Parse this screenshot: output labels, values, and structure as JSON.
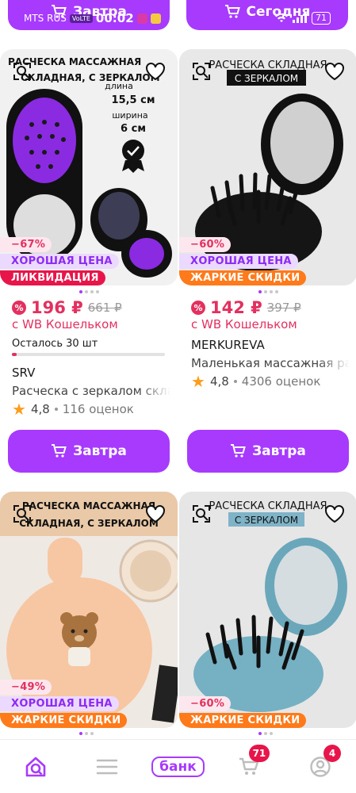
{
  "status_bar": {
    "carrier": "MTS RUS",
    "network": "VoLTE",
    "time": "00:02",
    "battery": "71"
  },
  "top_buttons": [
    {
      "label": "Завтра"
    },
    {
      "label": "Сегодня"
    }
  ],
  "products": [
    {
      "image_text": {
        "line1": "РАСЧЕСКА МАССАЖНАЯ",
        "line2": "СКЛАДНАЯ, С ЗЕРКАЛОМ",
        "length_label": "длина",
        "length_value": "15,5 см",
        "width_label": "ширина",
        "width_value": "6 см"
      },
      "discount": "−67%",
      "badge_primary": "ХОРОШАЯ ЦЕНА",
      "badge_secondary": "ЛИКВИДАЦИЯ",
      "price": "196 ₽",
      "old_price": "661 ₽",
      "wallet_note": "с WB Кошельком",
      "stock_label": "Осталось 30 шт",
      "stock_fraction": 0.03,
      "brand": "SRV",
      "title": "Расческа с зеркалом складная",
      "rating": "4,8",
      "reviews": "116 оценок",
      "buy_label": "Завтра"
    },
    {
      "image_text": {
        "line1": "РАСЧЕСКА СКЛАДНАЯ",
        "line2": "С ЗЕРКАЛОМ"
      },
      "discount": "−60%",
      "badge_primary": "ХОРОШАЯ ЦЕНА",
      "badge_secondary": "ЖАРКИЕ СКИДКИ",
      "price": "142 ₽",
      "old_price": "397 ₽",
      "wallet_note": "с WB Кошельком",
      "brand": "MERKUREVA",
      "title": "Маленькая массажная расческа",
      "rating": "4,8",
      "reviews": "4306 оценок",
      "buy_label": "Завтра"
    },
    {
      "image_text": {
        "line1": "РАСЧЕСКА МАССАЖНАЯ",
        "line2": "СКЛАДНАЯ, С ЗЕРКАЛОМ"
      },
      "discount": "−49%",
      "badge_primary": "ХОРОШАЯ ЦЕНА",
      "badge_secondary": "ЖАРКИЕ СКИДКИ"
    },
    {
      "image_text": {
        "line1": "РАСЧЕСКА СКЛАДНАЯ",
        "line2": "С ЗЕРКАЛОМ"
      },
      "discount": "−60%",
      "badge_secondary": "ЖАРКИЕ СКИДКИ"
    }
  ],
  "nav": {
    "home_icon": "home-search-icon",
    "menu_icon": "menu-icon",
    "bank_label": "банк",
    "cart_icon": "cart-icon",
    "cart_count": "71",
    "profile_icon": "profile-icon",
    "profile_count": "4"
  },
  "colors": {
    "accent": "#a73afd",
    "price": "#e3305f",
    "hot": "#ff7a1a"
  }
}
